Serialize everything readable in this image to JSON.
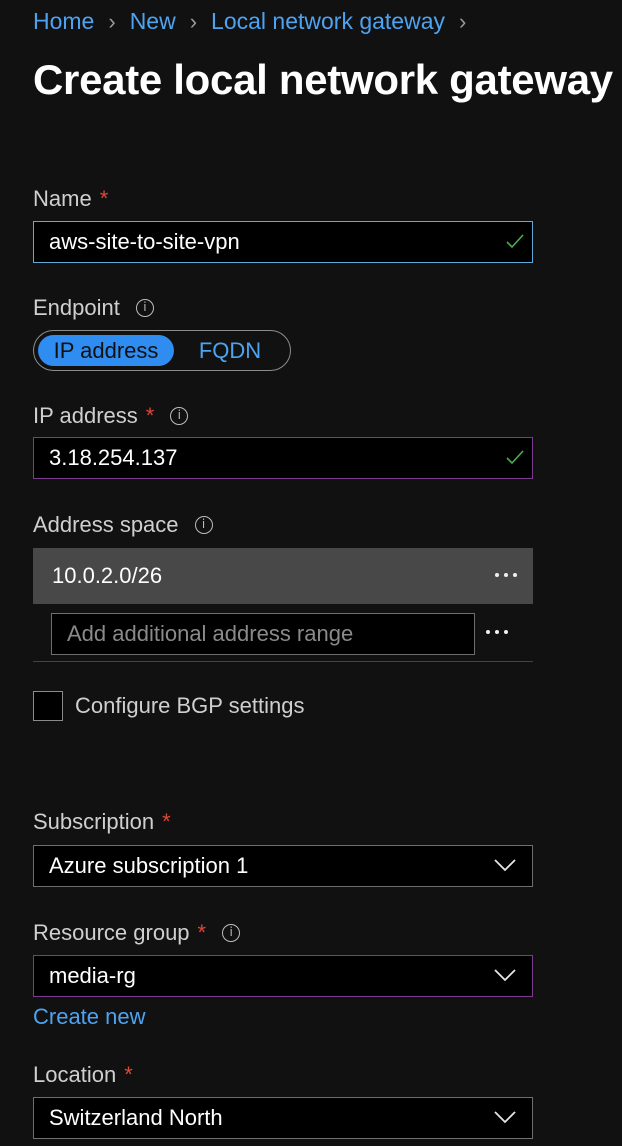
{
  "breadcrumb": {
    "items": [
      "Home",
      "New",
      "Local network gateway"
    ]
  },
  "page_title": "Create local network gateway",
  "form": {
    "name": {
      "label": "Name",
      "required_mark": "*",
      "value": "aws-site-to-site-vpn"
    },
    "endpoint": {
      "label": "Endpoint",
      "options": [
        "IP address",
        "FQDN"
      ],
      "selected": "IP address"
    },
    "ip_address": {
      "label": "IP address",
      "required_mark": "*",
      "value": "3.18.254.137"
    },
    "address_space": {
      "label": "Address space",
      "ranges": [
        "10.0.2.0/26"
      ],
      "add_placeholder": "Add additional address range"
    },
    "bgp": {
      "label": "Configure BGP settings",
      "checked": false
    },
    "subscription": {
      "label": "Subscription",
      "required_mark": "*",
      "value": "Azure subscription 1"
    },
    "resource_group": {
      "label": "Resource group",
      "required_mark": "*",
      "value": "media-rg",
      "create_new_label": "Create new"
    },
    "location": {
      "label": "Location",
      "required_mark": "*",
      "value": "Switzerland North"
    }
  },
  "colors": {
    "link": "#4ea3f1",
    "required": "#e0463a",
    "valid_check": "#4caf50",
    "toggle_selected": "#2f8cf0"
  },
  "icons": {
    "breadcrumb_separator": "chevron-right-icon",
    "info": "info-icon",
    "valid": "checkmark-icon",
    "dropdown": "chevron-down-icon",
    "more": "more-ellipsis-icon"
  }
}
